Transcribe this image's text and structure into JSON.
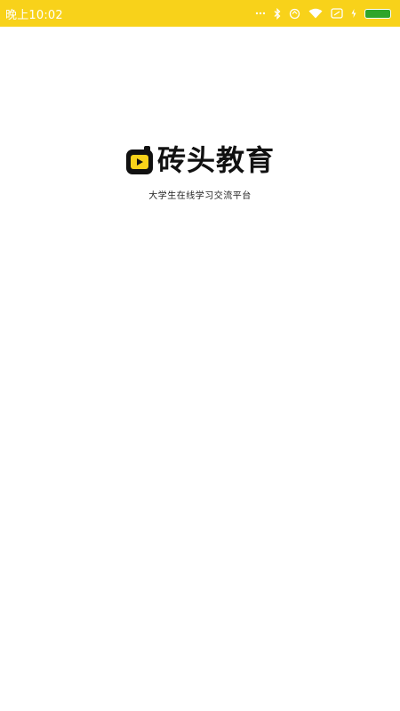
{
  "status_bar": {
    "time": "晚上10:02",
    "background_color": "#f8d21a",
    "icons": [
      "dots-icon",
      "bluetooth-icon",
      "sync-icon",
      "wifi-icon",
      "sim-icon",
      "charging-icon",
      "battery-icon"
    ],
    "battery_color": "#2ea52a"
  },
  "splash": {
    "brand_name": "砖头教育",
    "tagline": "大学生在线学习交流平台",
    "logo_colors": {
      "frame": "#111111",
      "accent": "#f8d21a"
    }
  }
}
